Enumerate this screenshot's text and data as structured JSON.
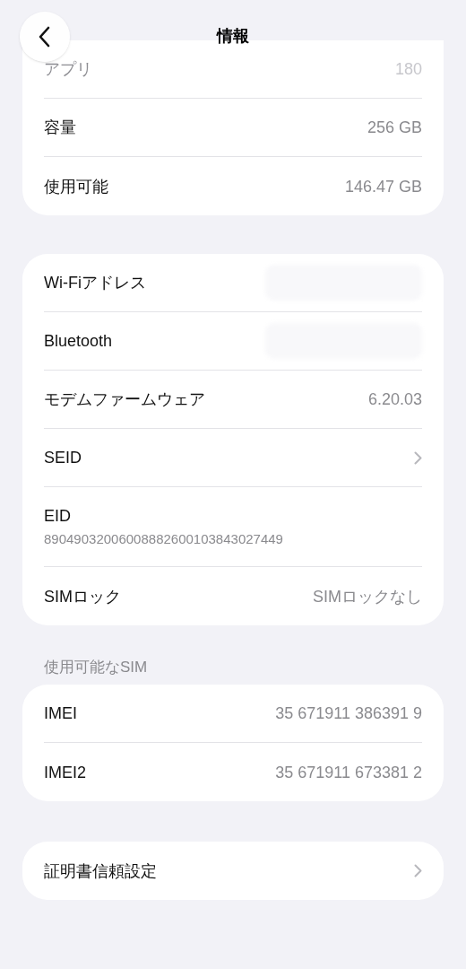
{
  "header": {
    "title": "情報"
  },
  "sections": [
    {
      "rows": [
        {
          "kind": "value",
          "label": "アプリ",
          "value": "180",
          "dimmed": true
        },
        {
          "kind": "value",
          "label": "容量",
          "value": "256 GB",
          "dimmed": false
        },
        {
          "kind": "value",
          "label": "使用可能",
          "value": "146.47 GB",
          "dimmed": false
        }
      ]
    },
    {
      "rows": [
        {
          "kind": "redacted",
          "label": "Wi-Fiアドレス",
          "dimmed": false
        },
        {
          "kind": "redacted",
          "label": "Bluetooth",
          "dimmed": false
        },
        {
          "kind": "value",
          "label": "モデムファームウェア",
          "value": "6.20.03",
          "dimmed": false
        },
        {
          "kind": "chevron",
          "label": "SEID",
          "dimmed": false
        },
        {
          "kind": "stacked",
          "label": "EID",
          "value": "89049032006008882600103843027449",
          "dimmed": false
        },
        {
          "kind": "value",
          "label": "SIMロック",
          "value": "SIMロックなし",
          "dimmed": false
        }
      ]
    },
    {
      "heading": "使用可能なSIM",
      "rows": [
        {
          "kind": "value",
          "label": "IMEI",
          "value": "35 671911 386391 9",
          "dimmed": false
        },
        {
          "kind": "value",
          "label": "IMEI2",
          "value": "35 671911 673381 2",
          "dimmed": false
        }
      ]
    },
    {
      "rows": [
        {
          "kind": "chevron",
          "label": "証明書信頼設定",
          "dimmed": false
        }
      ]
    }
  ]
}
